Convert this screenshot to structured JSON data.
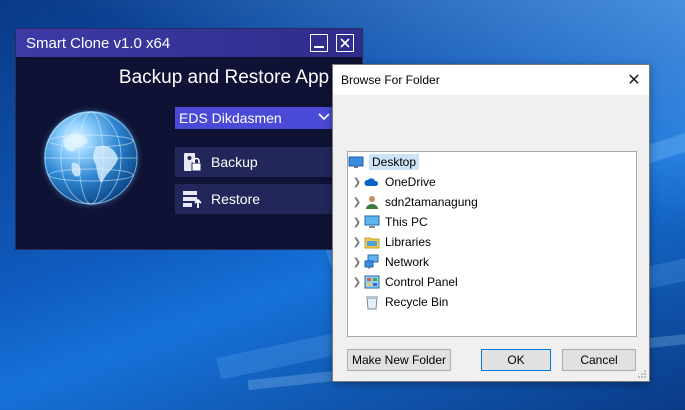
{
  "smart_clone": {
    "window_title": "Smart Clone v1.0 x64",
    "heading": "Backup and Restore App",
    "profile_selected": "EDS Dikdasmen",
    "backup_label": "Backup",
    "restore_label": "Restore",
    "accent_color": "#4a4ad6"
  },
  "browse_dialog": {
    "title": "Browse For Folder",
    "close_glyph": "✕",
    "tree": {
      "root": {
        "label": "Desktop",
        "icon": "desktop-icon"
      },
      "children": [
        {
          "label": "OneDrive",
          "icon": "onedrive-icon",
          "expandable": true
        },
        {
          "label": "sdn2tamanagung",
          "icon": "user-icon",
          "expandable": true
        },
        {
          "label": "This PC",
          "icon": "computer-icon",
          "expandable": true
        },
        {
          "label": "Libraries",
          "icon": "libraries-icon",
          "expandable": true
        },
        {
          "label": "Network",
          "icon": "network-icon",
          "expandable": true
        },
        {
          "label": "Control Panel",
          "icon": "control-panel-icon",
          "expandable": true
        },
        {
          "label": "Recycle Bin",
          "icon": "recycle-bin-icon",
          "expandable": false
        }
      ]
    },
    "buttons": {
      "new_folder": "Make New Folder",
      "ok": "OK",
      "cancel": "Cancel"
    }
  }
}
